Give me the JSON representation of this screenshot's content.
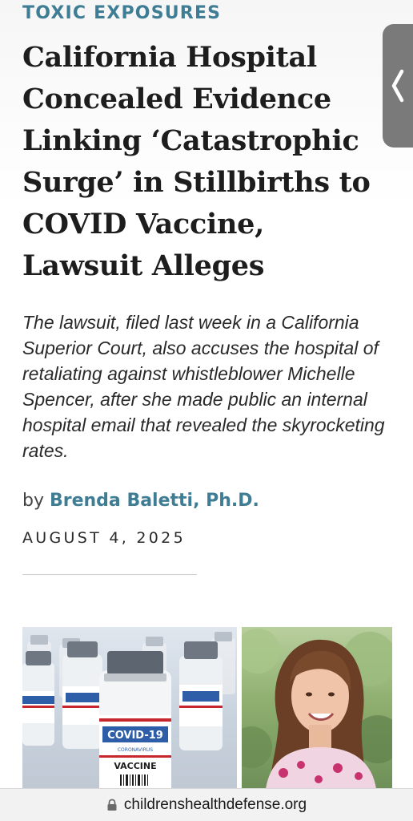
{
  "article": {
    "category": "TOXIC EXPOSURES",
    "headline": "California Hospital Concealed Evidence Linking ‘Catastrophic Surge’ in Stillbirths to COVID Vaccine, Lawsuit Alleges",
    "dek": "The lawsuit, filed last week in a California Superior Court, also accuses the hospital of retaliating against whistleblower Michelle Spencer, after she made public an internal hospital email that revealed the skyrocketing rates.",
    "byline_prefix": "by",
    "author": "Brenda Baletti, Ph.D.",
    "date": "AUGUST 4, 2025"
  },
  "images": {
    "vaccine_label_top": "COVID-19",
    "vaccine_label_sub": "CORONAVIRUS",
    "vaccine_label_main": "VACCINE"
  },
  "side_tab": {
    "icon": "chevron-left-icon"
  },
  "browser": {
    "url": "childrenshealthdefense.org",
    "lock_icon": "lock-icon"
  },
  "colors": {
    "accent": "#3f7d94",
    "headline": "#1d1d1d",
    "side_tab": "#7a7a7a"
  }
}
